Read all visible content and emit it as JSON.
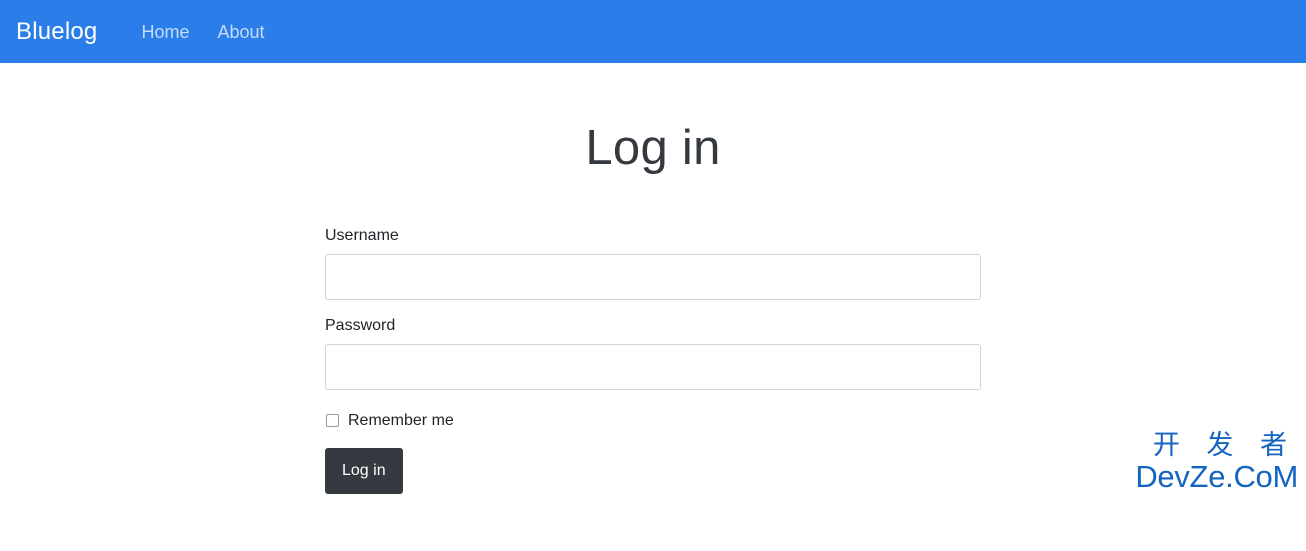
{
  "navbar": {
    "brand": "Bluelog",
    "background_color": "#2b7de9",
    "links": [
      {
        "label": "Home",
        "name": "nav-link-home"
      },
      {
        "label": "About",
        "name": "nav-link-about"
      }
    ]
  },
  "main": {
    "title": "Log in",
    "form": {
      "username": {
        "label": "Username",
        "value": "",
        "placeholder": ""
      },
      "password": {
        "label": "Password",
        "value": "",
        "placeholder": ""
      },
      "remember": {
        "label": "Remember me",
        "checked": false
      },
      "submit_label": "Log in",
      "submit_color": "#343a40"
    }
  },
  "watermark": {
    "line1": "开 发 者",
    "line2": "DevZe.CoM",
    "color": "#1464c0"
  }
}
